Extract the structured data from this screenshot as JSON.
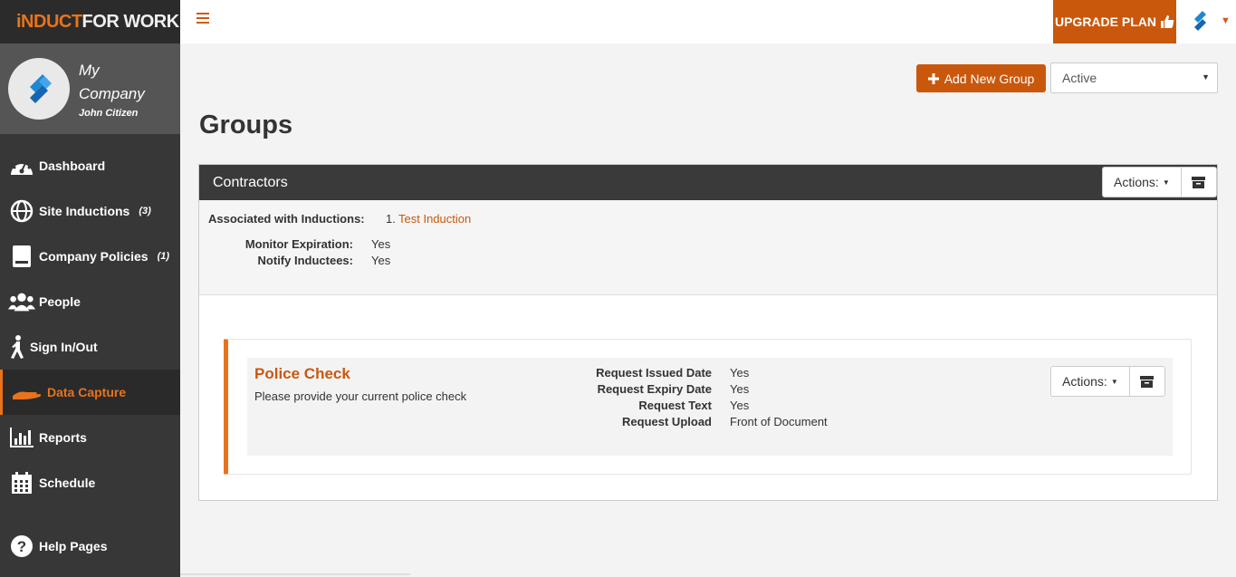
{
  "brand": {
    "part1": "iNDUCT",
    "part2": "FOR WORK"
  },
  "profile": {
    "company_line1": "My",
    "company_line2": "Company",
    "user": "John Citizen"
  },
  "nav": [
    {
      "label": "Dashboard",
      "icon": "dashboard-icon",
      "count": ""
    },
    {
      "label": "Site Inductions",
      "icon": "globe-icon",
      "count": "(3)"
    },
    {
      "label": "Company Policies",
      "icon": "book-icon",
      "count": "(1)"
    },
    {
      "label": "People",
      "icon": "people-icon",
      "count": ""
    },
    {
      "label": "Sign In/Out",
      "icon": "walking-icon",
      "count": ""
    },
    {
      "label": "Data Capture",
      "icon": "hand-icon",
      "count": ""
    },
    {
      "label": "Reports",
      "icon": "bar-chart-icon",
      "count": ""
    },
    {
      "label": "Schedule",
      "icon": "calendar-icon",
      "count": ""
    },
    {
      "label": "Help Pages",
      "icon": "help-icon",
      "count": ""
    }
  ],
  "active_nav": "Data Capture",
  "topbar": {
    "upgrade_label": "UPGRADE PLAN"
  },
  "toolbar": {
    "add_group_label": "Add New Group",
    "status_value": "Active"
  },
  "page": {
    "title": "Groups"
  },
  "group": {
    "name": "Contractors",
    "actions_label": "Actions:",
    "associated_label": "Associated with Inductions:",
    "inductions": [
      {
        "num": "1.",
        "name": "Test Induction"
      }
    ],
    "monitor_label": "Monitor Expiration:",
    "monitor_value": "Yes",
    "notify_label": "Notify Inductees:",
    "notify_value": "Yes"
  },
  "card": {
    "title": "Police Check",
    "description": "Please provide your current police check",
    "actions_label": "Actions:",
    "requests": [
      {
        "label": "Request Issued Date",
        "value": "Yes"
      },
      {
        "label": "Request Expiry Date",
        "value": "Yes"
      },
      {
        "label": "Request Text",
        "value": "Yes"
      },
      {
        "label": "Request Upload",
        "value": "Front of Document"
      }
    ]
  },
  "colors": {
    "accent": "#c9580d",
    "sidebar": "#373737",
    "active_accent": "#e8731c"
  }
}
